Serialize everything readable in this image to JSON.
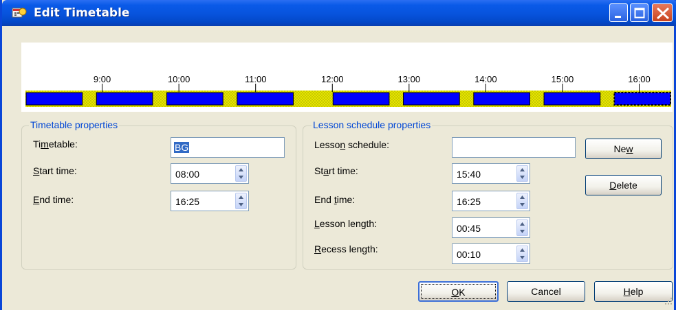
{
  "window": {
    "title": "Edit Timetable",
    "icon": "app-icon",
    "controls": [
      "minimize-icon",
      "maximize-icon",
      "close-icon"
    ]
  },
  "timeline": {
    "tick_labels": [
      "9:00",
      "10:00",
      "11:00",
      "12:00",
      "13:00",
      "14:00",
      "15:00",
      "16:00"
    ],
    "lesson_color": "#0000ff",
    "recess_color": "#e6e600",
    "start": "08:00",
    "end": "16:25",
    "blocks": [
      {
        "type": "lesson",
        "start": "08:00",
        "end": "08:45"
      },
      {
        "type": "recess",
        "start": "08:45",
        "end": "08:55"
      },
      {
        "type": "lesson",
        "start": "08:55",
        "end": "09:40"
      },
      {
        "type": "recess",
        "start": "09:40",
        "end": "09:50"
      },
      {
        "type": "lesson",
        "start": "09:50",
        "end": "10:35"
      },
      {
        "type": "recess",
        "start": "10:35",
        "end": "10:45"
      },
      {
        "type": "lesson",
        "start": "10:45",
        "end": "11:30"
      },
      {
        "type": "recess",
        "start": "11:30",
        "end": "12:00"
      },
      {
        "type": "lesson",
        "start": "12:00",
        "end": "12:45"
      },
      {
        "type": "recess",
        "start": "12:45",
        "end": "12:55"
      },
      {
        "type": "lesson",
        "start": "12:55",
        "end": "13:40"
      },
      {
        "type": "recess",
        "start": "13:40",
        "end": "13:50"
      },
      {
        "type": "lesson",
        "start": "13:50",
        "end": "14:35"
      },
      {
        "type": "recess",
        "start": "14:35",
        "end": "14:45"
      },
      {
        "type": "lesson",
        "start": "14:45",
        "end": "15:30"
      },
      {
        "type": "recess",
        "start": "15:30",
        "end": "15:40"
      },
      {
        "type": "lesson",
        "start": "15:40",
        "end": "16:25",
        "selected": true
      }
    ]
  },
  "timetable_properties": {
    "legend": "Timetable properties",
    "timetable_label": {
      "pre": "Ti",
      "key": "m",
      "post": "etable:"
    },
    "timetable_value": "BG",
    "start_label": {
      "pre": "",
      "key": "S",
      "post": "tart time:"
    },
    "start_value": "08:00",
    "end_label": {
      "pre": "",
      "key": "E",
      "post": "nd time:"
    },
    "end_value": "16:25"
  },
  "lesson_properties": {
    "legend": "Lesson schedule properties",
    "schedule_label": {
      "pre": "Lesso",
      "key": "n",
      "post": " schedule:"
    },
    "schedule_value": "",
    "start_label": {
      "pre": "St",
      "key": "a",
      "post": "rt time:"
    },
    "start_value": "15:40",
    "end_label": {
      "pre": "End ",
      "key": "t",
      "post": "ime:"
    },
    "end_value": "16:25",
    "lesson_length_label": {
      "pre": "",
      "key": "L",
      "post": "esson length:"
    },
    "lesson_length_value": "00:45",
    "recess_length_label": {
      "pre": "",
      "key": "R",
      "post": "ecess length:"
    },
    "recess_length_value": "00:10"
  },
  "buttons": {
    "new": {
      "pre": "Ne",
      "key": "w",
      "post": ""
    },
    "delete": {
      "pre": "",
      "key": "D",
      "post": "elete"
    },
    "ok": {
      "pre": "",
      "key": "O",
      "post": "K"
    },
    "cancel": {
      "pre": "Cancel",
      "key": "",
      "post": ""
    },
    "help": {
      "pre": "",
      "key": "H",
      "post": "elp"
    }
  }
}
